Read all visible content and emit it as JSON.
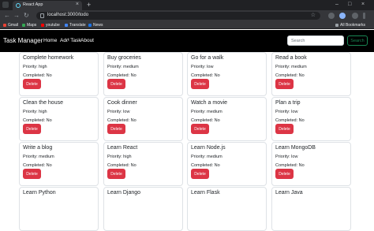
{
  "browser": {
    "tab_title": "React App",
    "tab_close": "×",
    "new_tab": "+",
    "url": "localhost:3000/todo",
    "window_controls": [
      "–",
      "□",
      "×"
    ],
    "bookmarks": [
      {
        "label": "Gmail",
        "color": "#ea4335"
      },
      {
        "label": "Maps",
        "color": "#34a853"
      },
      {
        "label": "youtube",
        "color": "#ff0000"
      },
      {
        "label": "Translate",
        "color": "#4285f4"
      },
      {
        "label": "News",
        "color": "#1a73e8"
      }
    ],
    "all_bookmarks": "All Bookmarks",
    "nav_icons": [
      "back-arrow-icon",
      "forward-arrow-icon",
      "reload-icon"
    ],
    "glyphs": {
      "back": "←",
      "forward": "→",
      "reload": "↻",
      "star": "☆"
    }
  },
  "navbar": {
    "brand": "Task Manager",
    "links": [
      "Home",
      "Add Task",
      "About"
    ],
    "search_placeholder": "Search",
    "search_button": "Search"
  },
  "tasks": [
    {
      "title": "Complete homework",
      "priority": "Priority: high",
      "completed": "Completed: No"
    },
    {
      "title": "Buy groceries",
      "priority": "Priority: medium",
      "completed": "Completed: No"
    },
    {
      "title": "Go for a walk",
      "priority": "Priority: low",
      "completed": "Completed: No"
    },
    {
      "title": "Read a book",
      "priority": "Priority: medium",
      "completed": "Completed: No"
    },
    {
      "title": "Clean the house",
      "priority": "Priority: high",
      "completed": "Completed: No"
    },
    {
      "title": "Cook dinner",
      "priority": "Priority: low",
      "completed": "Completed: No"
    },
    {
      "title": "Watch a movie",
      "priority": "Priority: medium",
      "completed": "Completed: No"
    },
    {
      "title": "Plan a trip",
      "priority": "Priority: low",
      "completed": "Completed: No"
    },
    {
      "title": "Write a blog",
      "priority": "Priority: medium",
      "completed": "Completed: No"
    },
    {
      "title": "Learn React",
      "priority": "Priority: high",
      "completed": "Completed: No"
    },
    {
      "title": "Learn Node.js",
      "priority": "Priority: medium",
      "completed": "Completed: No"
    },
    {
      "title": "Learn MongoDB",
      "priority": "Priority: low",
      "completed": "Completed: No"
    },
    {
      "title": "Learn Python",
      "priority": "",
      "completed": ""
    },
    {
      "title": "Learn Django",
      "priority": "",
      "completed": ""
    },
    {
      "title": "Learn Flask",
      "priority": "",
      "completed": ""
    },
    {
      "title": "Learn Java",
      "priority": "",
      "completed": ""
    }
  ],
  "delete_label": "Delete",
  "colors": {
    "danger": "#dc3545",
    "success": "#198754",
    "navbar": "#000000"
  }
}
